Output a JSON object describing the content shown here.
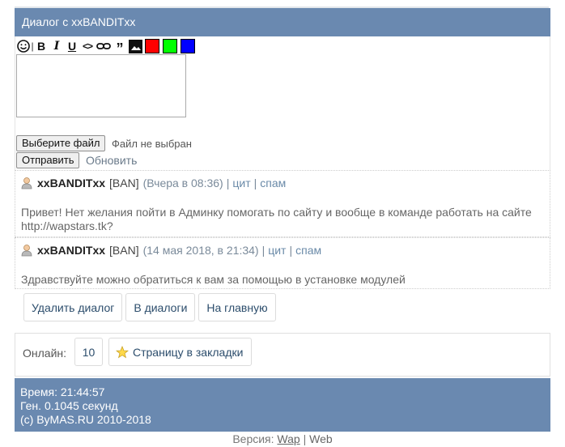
{
  "dialog": {
    "title": "Диалог с xxBANDITxx"
  },
  "toolbar": {
    "smile": "smiley-icon",
    "bold": "B",
    "italic": "I",
    "underline": "U",
    "code": "<>",
    "link": "link-icon",
    "quote": "”",
    "image": "image-icon",
    "colors": [
      "#ff0000",
      "#00ff00",
      "#0000ff"
    ]
  },
  "form": {
    "message_value": "",
    "file_button": "Выберите файл",
    "file_status": "Файл не выбран",
    "send_button": "Отправить",
    "refresh_link": "Обновить"
  },
  "messages": [
    {
      "nick": "xxBANDITxx",
      "ban": "[BAN]",
      "date": "(Вчера в 08:36)",
      "sep": "|",
      "quote": "цит",
      "spam": "спам",
      "text": "Привет! Нет желания пойти в Админку помогать по сайту и вообще в команде работать на сайте http://wapstars.tk?"
    },
    {
      "nick": "xxBANDITxx",
      "ban": "[BAN]",
      "date": "(14 мая 2018, в 21:34)",
      "sep": "|",
      "quote": "цит",
      "spam": "спам",
      "text": "Здравствуйте можно обратиться к вам за помощью в установке модулей"
    }
  ],
  "nav": {
    "delete_dialog": "Удалить диалог",
    "to_dialogs": "В диалоги",
    "home": "На главную"
  },
  "online": {
    "label": "Онлайн:",
    "count": "10",
    "bookmark": "Страницу в закладки"
  },
  "footer": {
    "time": "Время: 21:44:57",
    "gen": "Ген. 0.1045 секунд",
    "copyright": "(c) ByMAS.RU 2010-2018"
  },
  "version": {
    "label": "Версия:",
    "wap": "Wap",
    "sep": "|",
    "web": "Web"
  },
  "colors": {
    "header_bg": "#6a89b0",
    "link": "#2c4d6c"
  }
}
